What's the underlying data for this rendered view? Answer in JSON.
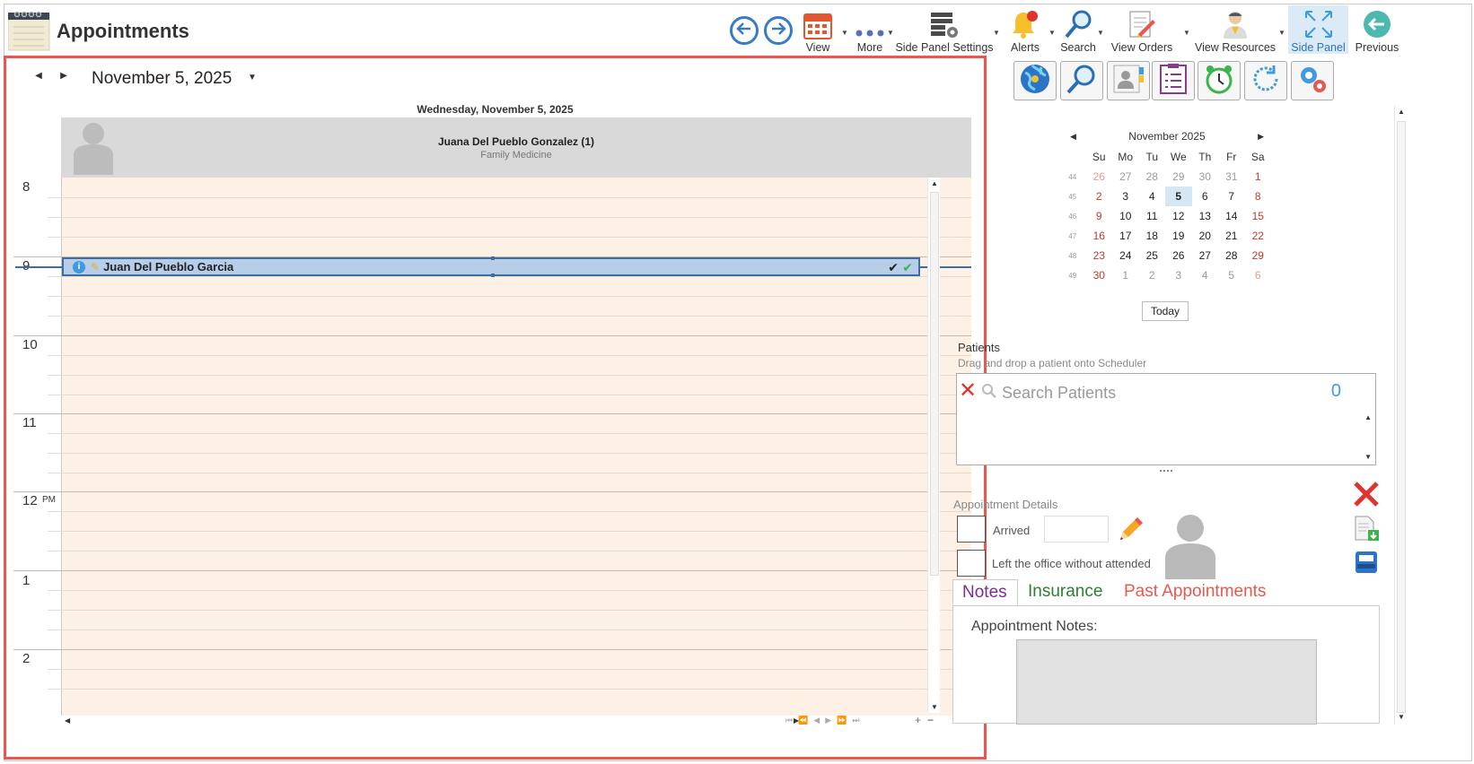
{
  "app": {
    "title": "Appointments"
  },
  "toolbar": {
    "back_label": "",
    "forward_label": "",
    "items": {
      "view": "View",
      "more": "More",
      "side_panel_settings": "Side Panel Settings",
      "alerts": "Alerts",
      "search": "Search",
      "view_orders": "View Orders",
      "view_resources": "View Resources",
      "side_panel": "Side Panel",
      "previous": "Previous"
    },
    "active_item": "side_panel",
    "accent_color": "#2e74b5"
  },
  "scheduler": {
    "current_date": "November 5, 2025",
    "day_header": "Wednesday, November 5, 2025",
    "resource": {
      "name": "Juana Del Pueblo Gonzalez (1)",
      "specialty": "Family Medicine"
    },
    "hours": [
      "8",
      "9",
      "10",
      "11",
      "12",
      "1",
      "2"
    ],
    "pm_marker": "PM",
    "appointment": {
      "patient": "Juan Del Pueblo Garcia",
      "start_hour": "9",
      "status_icons": [
        "check-icon",
        "green-check-icon"
      ]
    },
    "highlight_color": "#e8584e"
  },
  "side_panel": {
    "quick_buttons": [
      "globe-icon",
      "magnifier-icon",
      "patient-card-icon",
      "checklist-icon",
      "alarm-clock-icon",
      "refresh-icon",
      "settings-gears-icon"
    ],
    "mini_calendar": {
      "month_label": "November 2025",
      "weekdays": [
        "Su",
        "Mo",
        "Tu",
        "We",
        "Th",
        "Fr",
        "Sa"
      ],
      "weeks": [
        {
          "num": "44",
          "days": [
            "26",
            "27",
            "28",
            "29",
            "30",
            "31",
            "1"
          ]
        },
        {
          "num": "45",
          "days": [
            "2",
            "3",
            "4",
            "5",
            "6",
            "7",
            "8"
          ]
        },
        {
          "num": "46",
          "days": [
            "9",
            "10",
            "11",
            "12",
            "13",
            "14",
            "15"
          ]
        },
        {
          "num": "47",
          "days": [
            "16",
            "17",
            "18",
            "19",
            "20",
            "21",
            "22"
          ]
        },
        {
          "num": "48",
          "days": [
            "23",
            "24",
            "25",
            "26",
            "27",
            "28",
            "29"
          ]
        },
        {
          "num": "49",
          "days": [
            "30",
            "1",
            "2",
            "3",
            "4",
            "5",
            "6"
          ]
        }
      ],
      "selected_day": "5",
      "today_label": "Today"
    },
    "patients": {
      "label": "Patients",
      "hint": "Drag and drop a patient onto Scheduler",
      "search_placeholder": "Search Patients",
      "count": "0"
    },
    "appointment_details": {
      "label": "Appointment Details",
      "arrived_label": "Arrived",
      "left_office_label": "Left the office without attended",
      "arrived_checked": false,
      "left_checked": false
    },
    "tabs": [
      {
        "label": "Notes",
        "color": "#7b2d8e"
      },
      {
        "label": "Insurance",
        "color": "#2e7d32"
      },
      {
        "label": "Past Appointments",
        "color": "#e8584e"
      }
    ],
    "active_tab": "Notes",
    "notes_label": "Appointment Notes:"
  }
}
